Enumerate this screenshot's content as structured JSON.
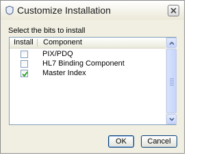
{
  "window": {
    "title": "Customize Installation"
  },
  "instruction": "Select the bits to install",
  "table": {
    "columns": [
      "Install",
      "Component"
    ],
    "rows": [
      {
        "component": "PIX/PDQ",
        "checked": false
      },
      {
        "component": "HL7 Binding Component",
        "checked": false
      },
      {
        "component": "Master Index",
        "checked": true
      }
    ]
  },
  "buttons": {
    "ok": "OK",
    "cancel": "Cancel"
  }
}
